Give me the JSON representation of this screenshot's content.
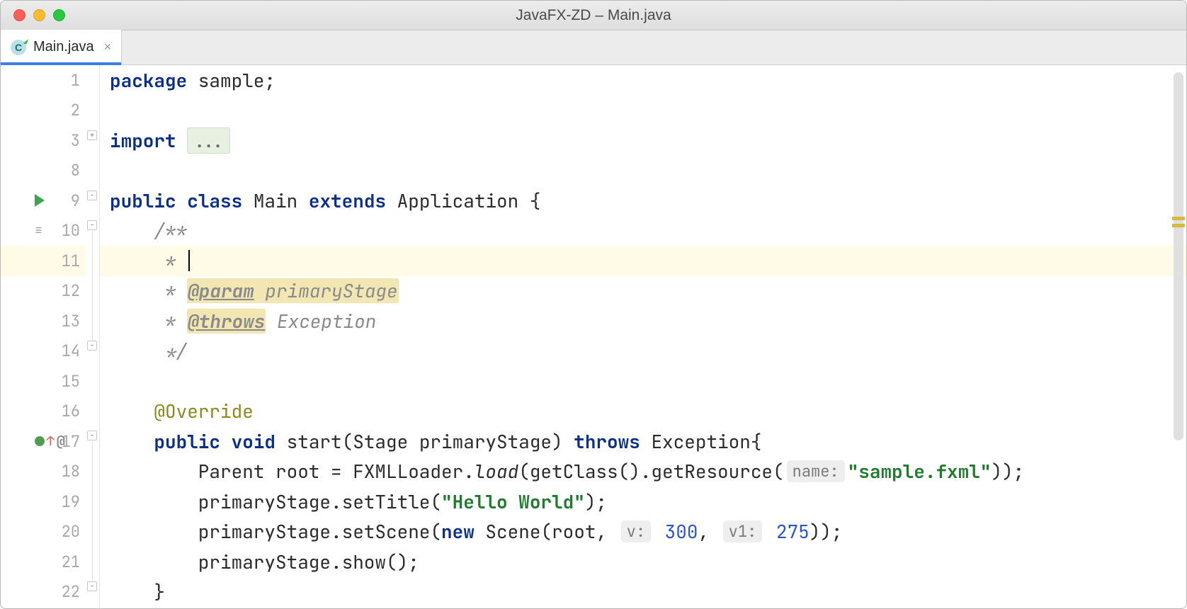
{
  "window": {
    "title": "JavaFX-ZD – Main.java"
  },
  "tab": {
    "label": "Main.java",
    "icon_letter": "C"
  },
  "gutter": {
    "lines": [
      "1",
      "2",
      "3",
      "8",
      "9",
      "10",
      "11",
      "12",
      "13",
      "14",
      "15",
      "16",
      "17",
      "18",
      "19",
      "20",
      "21",
      "22"
    ]
  },
  "code": {
    "l1_kw": "package",
    "l1_rest": " sample;",
    "l3_kw": "import",
    "l3_fold": "...",
    "l9_kw1": "public",
    "l9_kw2": "class",
    "l9_name": " Main ",
    "l9_kw3": "extends",
    "l9_rest": " Application {",
    "l10": "    /**",
    "l11": "     * ",
    "l12_pre": "     * ",
    "l12_tag": "@param",
    "l12_arg": " primaryStage",
    "l13_pre": "     * ",
    "l13_tag": "@throws",
    "l13_arg": " Exception",
    "l14": "     */",
    "l16": "    @Override",
    "l17_pre": "    ",
    "l17_kw1": "public",
    "l17_kw2": " void",
    "l17_mid": " start(Stage primaryStage) ",
    "l17_kw3": "throws",
    "l17_rest": " Exception{",
    "l18_pre": "        Parent root = FXMLLoader.",
    "l18_ital": "load",
    "l18_mid": "(getClass().getResource(",
    "l18_hint": "name:",
    "l18_str": "\"sample.fxml\"",
    "l18_end": "));",
    "l19_pre": "        primaryStage.setTitle(",
    "l19_str": "\"Hello World\"",
    "l19_end": ");",
    "l20_pre": "        primaryStage.setScene(",
    "l20_kw": "new",
    "l20_mid": " Scene(root, ",
    "l20_h1": "v:",
    "l20_n1": "300",
    "l20_c": ", ",
    "l20_h2": "v1:",
    "l20_n2": "275",
    "l20_end": "));",
    "l21": "        primaryStage.show();",
    "l22": "    }"
  }
}
